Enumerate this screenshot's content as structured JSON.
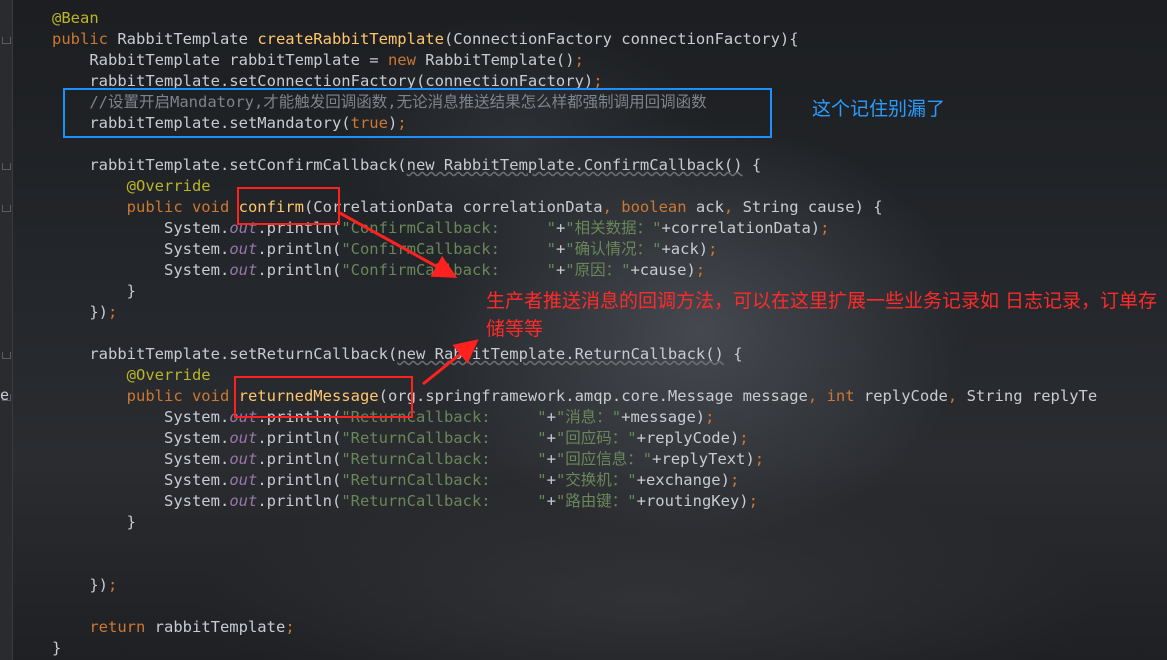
{
  "editor": {
    "code_lines": [
      [
        {
          "t": "@Bean",
          "c": "an"
        }
      ],
      [
        {
          "t": "public ",
          "c": "kw"
        },
        {
          "t": "RabbitTemplate "
        },
        {
          "t": "createRabbitTemplate",
          "c": "fn"
        },
        {
          "t": "(ConnectionFactory connectionFactory){"
        }
      ],
      [
        {
          "t": "    RabbitTemplate rabbitTemplate = "
        },
        {
          "t": "new ",
          "c": "kw"
        },
        {
          "t": "RabbitTemplate()"
        },
        {
          "t": ";",
          "c": "kw"
        }
      ],
      [
        {
          "t": "    rabbitTemplate.setConnectionFactory(connectionFactory)"
        },
        {
          "t": ";",
          "c": "kw"
        }
      ],
      [
        {
          "t": "    //设置开启Mandatory,才能触发回调函数,无论消息推送结果怎么样都强制调用回调函数",
          "c": "cm"
        }
      ],
      [
        {
          "t": "    rabbitTemplate.setMandatory("
        },
        {
          "t": "true",
          "c": "kw"
        },
        {
          "t": ")"
        },
        {
          "t": ";",
          "c": "kw"
        }
      ],
      [],
      [
        {
          "t": "    rabbitTemplate.setConfirmCallback("
        },
        {
          "t": "new RabbitTemplate.ConfirmCallback()",
          "c": "ul"
        },
        {
          "t": " {"
        }
      ],
      [
        {
          "t": "        @Override",
          "c": "an"
        }
      ],
      [
        {
          "t": "        public void ",
          "c": "kw"
        },
        {
          "t": "confirm",
          "c": "fn"
        },
        {
          "t": "(CorrelationData correlationData"
        },
        {
          "t": ", ",
          "c": "kw"
        },
        {
          "t": "boolean ",
          "c": "kw"
        },
        {
          "t": "ack"
        },
        {
          "t": ", ",
          "c": "kw"
        },
        {
          "t": "String cause) {"
        }
      ],
      [
        {
          "t": "            System."
        },
        {
          "t": "out",
          "c": "it"
        },
        {
          "t": ".println("
        },
        {
          "t": "\"ConfirmCallback:     \"",
          "c": "st"
        },
        {
          "t": "+"
        },
        {
          "t": "\"相关数据：\"",
          "c": "st"
        },
        {
          "t": "+correlationData)"
        },
        {
          "t": ";",
          "c": "kw"
        }
      ],
      [
        {
          "t": "            System."
        },
        {
          "t": "out",
          "c": "it"
        },
        {
          "t": ".println("
        },
        {
          "t": "\"ConfirmCallback:     \"",
          "c": "st"
        },
        {
          "t": "+"
        },
        {
          "t": "\"确认情况：\"",
          "c": "st"
        },
        {
          "t": "+ack)"
        },
        {
          "t": ";",
          "c": "kw"
        }
      ],
      [
        {
          "t": "            System."
        },
        {
          "t": "out",
          "c": "it"
        },
        {
          "t": ".println("
        },
        {
          "t": "\"ConfirmCallback:     \"",
          "c": "st"
        },
        {
          "t": "+"
        },
        {
          "t": "\"原因：\"",
          "c": "st"
        },
        {
          "t": "+cause)"
        },
        {
          "t": ";",
          "c": "kw"
        }
      ],
      [
        {
          "t": "        }"
        }
      ],
      [
        {
          "t": "    })"
        },
        {
          "t": ";",
          "c": "kw"
        }
      ],
      [],
      [
        {
          "t": "    rabbitTemplate.setReturnCallback("
        },
        {
          "t": "new RabbitTemplate.ReturnCallback()",
          "c": "ul"
        },
        {
          "t": " {"
        }
      ],
      [
        {
          "t": "        @Override",
          "c": "an"
        }
      ],
      [
        {
          "t": "        public void ",
          "c": "kw"
        },
        {
          "t": "returnedMessage",
          "c": "fn"
        },
        {
          "t": "(org.springframework.amqp.core.Message message"
        },
        {
          "t": ", ",
          "c": "kw"
        },
        {
          "t": "int ",
          "c": "kw"
        },
        {
          "t": "replyCode"
        },
        {
          "t": ", ",
          "c": "kw"
        },
        {
          "t": "String replyTe"
        }
      ],
      [
        {
          "t": "            System."
        },
        {
          "t": "out",
          "c": "it"
        },
        {
          "t": ".println("
        },
        {
          "t": "\"ReturnCallback:     \"",
          "c": "st"
        },
        {
          "t": "+"
        },
        {
          "t": "\"消息：\"",
          "c": "st"
        },
        {
          "t": "+message)"
        },
        {
          "t": ";",
          "c": "kw"
        }
      ],
      [
        {
          "t": "            System."
        },
        {
          "t": "out",
          "c": "it"
        },
        {
          "t": ".println("
        },
        {
          "t": "\"ReturnCallback:     \"",
          "c": "st"
        },
        {
          "t": "+"
        },
        {
          "t": "\"回应码：\"",
          "c": "st"
        },
        {
          "t": "+replyCode)"
        },
        {
          "t": ";",
          "c": "kw"
        }
      ],
      [
        {
          "t": "            System."
        },
        {
          "t": "out",
          "c": "it"
        },
        {
          "t": ".println("
        },
        {
          "t": "\"ReturnCallback:     \"",
          "c": "st"
        },
        {
          "t": "+"
        },
        {
          "t": "\"回应信息：\"",
          "c": "st"
        },
        {
          "t": "+replyText)"
        },
        {
          "t": ";",
          "c": "kw"
        }
      ],
      [
        {
          "t": "            System."
        },
        {
          "t": "out",
          "c": "it"
        },
        {
          "t": ".println("
        },
        {
          "t": "\"ReturnCallback:     \"",
          "c": "st"
        },
        {
          "t": "+"
        },
        {
          "t": "\"交换机：\"",
          "c": "st"
        },
        {
          "t": "+exchange)"
        },
        {
          "t": ";",
          "c": "kw"
        }
      ],
      [
        {
          "t": "            System."
        },
        {
          "t": "out",
          "c": "it"
        },
        {
          "t": ".println("
        },
        {
          "t": "\"ReturnCallback:     \"",
          "c": "st"
        },
        {
          "t": "+"
        },
        {
          "t": "\"路由键：\"",
          "c": "st"
        },
        {
          "t": "+routingKey)"
        },
        {
          "t": ";",
          "c": "kw"
        }
      ],
      [
        {
          "t": "        }"
        }
      ],
      [],
      [],
      [
        {
          "t": "    })"
        },
        {
          "t": ";",
          "c": "kw"
        }
      ],
      [],
      [
        {
          "t": "    return ",
          "c": "kw"
        },
        {
          "t": "rabbitTemplate"
        },
        {
          "t": ";",
          "c": "kw"
        }
      ],
      [
        {
          "t": "}"
        }
      ]
    ],
    "left_edge_char": "e"
  },
  "annotations": {
    "remember_note": "这个记住别漏了",
    "producer_note": "生产者推送消息的回调方法，可以在这里扩展一些业务记录如 日志记录，订单存储等等"
  },
  "colors": {
    "blue_box": "#1e8fff",
    "red_box": "#ff2020",
    "blue_text": "#2a9cff",
    "red_text": "#ff2a2a"
  }
}
